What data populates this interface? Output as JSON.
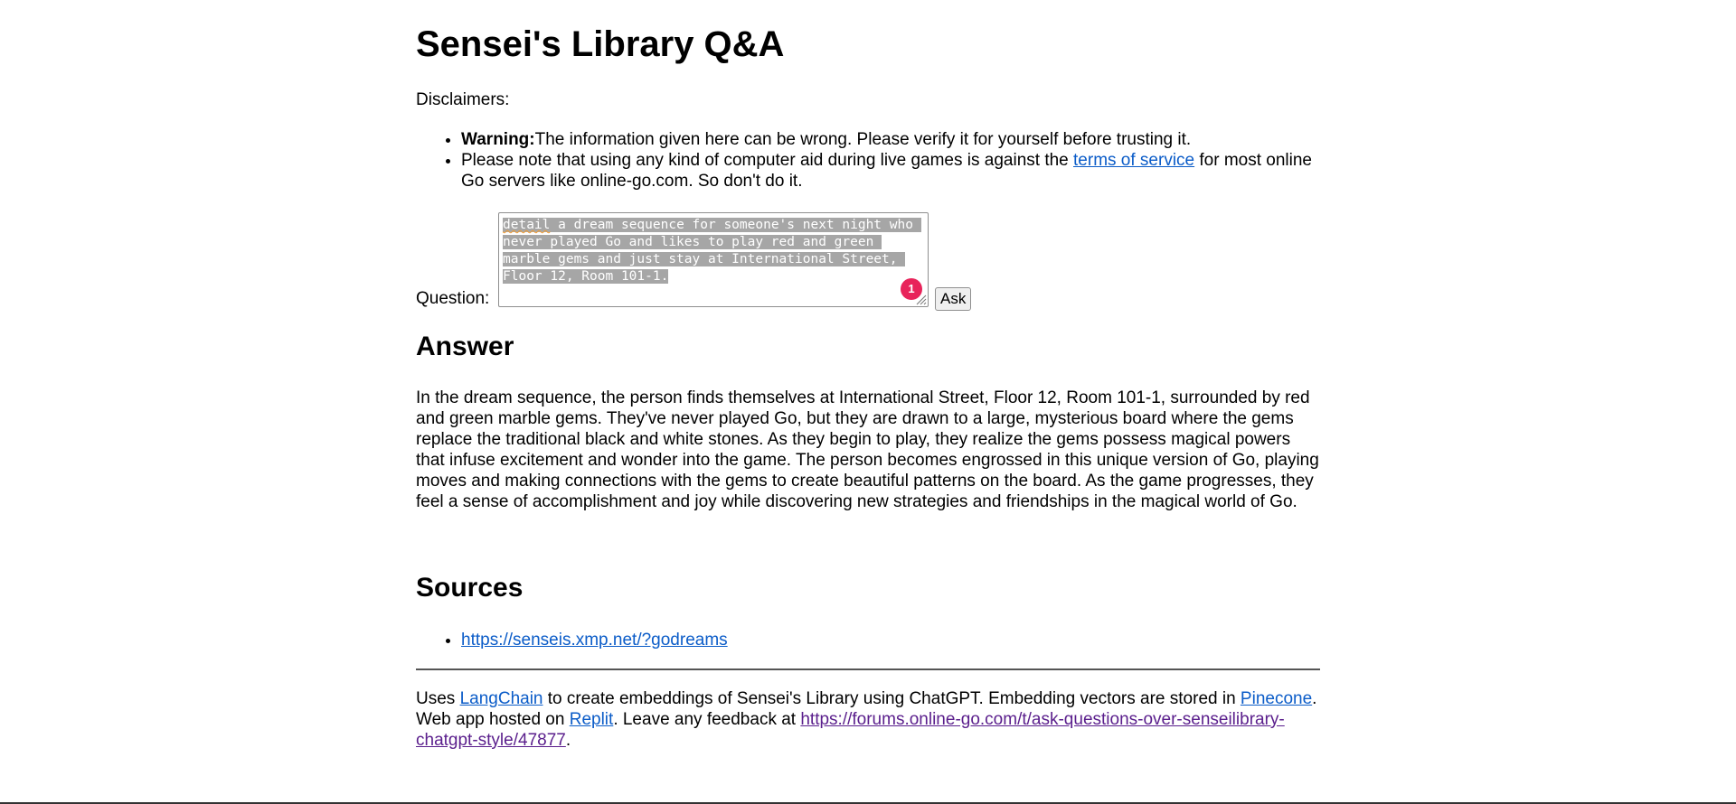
{
  "page_title": "Sensei's Library Q&A",
  "disclaimers_label": "Disclaimers:",
  "disclaimers": {
    "warning_bold": "Warning:",
    "warning_text": "The information given here can be wrong. Please verify it for yourself before trusting it.",
    "tos_text_before": "Please note that using any kind of computer aid during live games is against the ",
    "tos_link": "terms of service",
    "tos_text_after": " for most online Go servers like online-go.com. So don't do it."
  },
  "question": {
    "label": "Question:",
    "first_word": "detail",
    "value_rest": " a dream sequence for someone's next night who never played Go and likes to play red and green marble gems and just stay at International Street, Floor 12, Room 101-1.",
    "badge_count": "1",
    "ask_button": "Ask"
  },
  "answer": {
    "heading": "Answer",
    "text": "In the dream sequence, the person finds themselves at International Street, Floor 12, Room 101-1, surrounded by red and green marble gems. They've never played Go, but they are drawn to a large, mysterious board where the gems replace the traditional black and white stones. As they begin to play, they realize the gems possess magical powers that infuse excitement and wonder into the game. The person becomes engrossed in this unique version of Go, playing moves and making connections with the gems to create beautiful patterns on the board. As the game progresses, they feel a sense of accomplishment and joy while discovering new strategies and friendships in the magical world of Go."
  },
  "sources": {
    "heading": "Sources",
    "items": [
      "https://senseis.xmp.net/?godreams"
    ]
  },
  "footer": {
    "t1": "Uses ",
    "langchain": "LangChain",
    "t2": " to create embeddings of Sensei's Library using ChatGPT. Embedding vectors are stored in ",
    "pinecone": "Pinecone",
    "t3": ". Web app hosted on ",
    "replit": "Replit",
    "t4": ". Leave any feedback at ",
    "feedback_link": "https://forums.online-go.com/t/ask-questions-over-senseilibrary-chatgpt-style/47877",
    "t5": "."
  },
  "colors": {
    "link": "#0b5cc8",
    "visited_link": "#5a1e8c",
    "badge": "#e8235a",
    "selection": "#a6a6a6"
  }
}
